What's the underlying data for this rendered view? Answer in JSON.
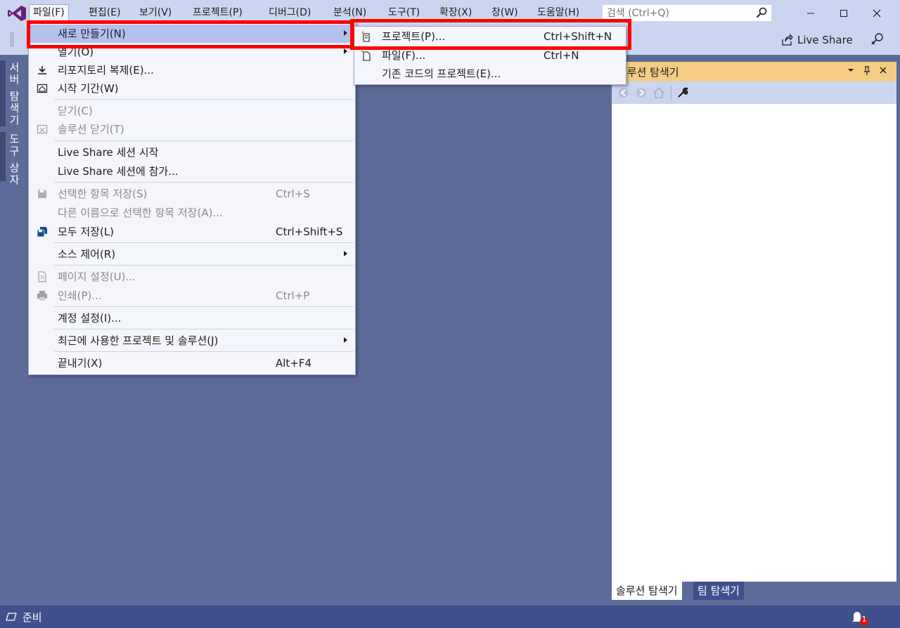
{
  "menubar": {
    "items": [
      {
        "label": "파일(F)",
        "active": true
      },
      {
        "label": "편집(E)"
      },
      {
        "label": "보기(V)"
      },
      {
        "label": "프로젝트(P)"
      },
      {
        "label": "디버그(D)"
      },
      {
        "label": "분석(N)"
      },
      {
        "label": "도구(T)"
      },
      {
        "label": "확장(X)"
      },
      {
        "label": "창(W)"
      },
      {
        "label": "도움말(H)"
      }
    ],
    "search_placeholder": "검색 (Ctrl+Q)"
  },
  "toolbar": {
    "liveshare_label": "Live Share"
  },
  "left_tabs": {
    "server_explorer": "서버 탐색기",
    "toolbox": "도구 상자"
  },
  "file_menu": {
    "items": [
      {
        "label": "새로 만들기(N)",
        "submenu": true,
        "hover": true
      },
      {
        "label": "열기(O)",
        "submenu": true
      },
      {
        "label": "리포지토리 복제(E)...",
        "icon": "clone-icon"
      },
      {
        "label": "시작 기간(W)",
        "icon": "start-window-icon"
      },
      {
        "label": "닫기(C)",
        "disabled": true
      },
      {
        "label": "솔루션 닫기(T)",
        "disabled": true,
        "icon": "close-solution-icon"
      },
      {
        "label": "Live Share 세션 시작"
      },
      {
        "label": "Live Share 세션에 참가..."
      },
      {
        "label": "선택한 항목 저장(S)",
        "shortcut": "Ctrl+S",
        "disabled": true,
        "icon": "save-icon"
      },
      {
        "label": "다른 이름으로 선택한 항목 저장(A)...",
        "disabled": true
      },
      {
        "label": "모두 저장(L)",
        "shortcut": "Ctrl+Shift+S",
        "icon": "save-all-icon"
      },
      {
        "label": "소스 제어(R)",
        "submenu": true
      },
      {
        "label": "페이지 설정(U)...",
        "disabled": true,
        "icon": "page-setup-icon"
      },
      {
        "label": "인쇄(P)...",
        "shortcut": "Ctrl+P",
        "disabled": true,
        "icon": "print-icon"
      },
      {
        "label": "계정 설정(I)..."
      },
      {
        "label": "최근에 사용한 프로젝트 및 솔루션(J)",
        "submenu": true
      },
      {
        "label": "끝내기(X)",
        "shortcut": "Alt+F4"
      }
    ]
  },
  "new_submenu": {
    "items": [
      {
        "label": "프로젝트(P)...",
        "shortcut": "Ctrl+Shift+N",
        "icon": "new-project-icon"
      },
      {
        "label": "파일(F)...",
        "shortcut": "Ctrl+N",
        "icon": "new-file-icon"
      },
      {
        "label": "기존 코드의 프로젝트(E)..."
      }
    ]
  },
  "solution_explorer": {
    "title": "솔루션 탐색기",
    "tabs": [
      "솔루션 탐색기",
      "팀 탐색기"
    ]
  },
  "statusbar": {
    "text": "준비",
    "notification_count": "1"
  },
  "colors": {
    "background": "#5d6b99",
    "menubar": "#ccd5f0",
    "highlight": "#ff0000",
    "panel_header": "#f5cc84",
    "statusbar": "#40508d"
  }
}
